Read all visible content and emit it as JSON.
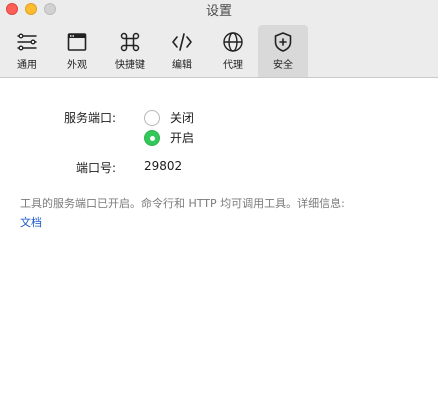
{
  "window": {
    "title": "设置",
    "traffic_lights": [
      "close",
      "minimize",
      "zoom"
    ]
  },
  "toolbar": {
    "tabs": [
      {
        "label": "通用",
        "icon": "sliders-icon",
        "active": false
      },
      {
        "label": "外观",
        "icon": "window-icon",
        "active": false
      },
      {
        "label": "快捷键",
        "icon": "command-key-icon",
        "active": false
      },
      {
        "label": "编辑",
        "icon": "code-brackets-icon",
        "active": false
      },
      {
        "label": "代理",
        "icon": "globe-icon",
        "active": false
      },
      {
        "label": "安全",
        "icon": "shield-plus-icon",
        "active": true
      }
    ]
  },
  "settings": {
    "service_port_label": "服务端口:",
    "options": [
      {
        "label": "关闭",
        "selected": false
      },
      {
        "label": "开启",
        "selected": true
      }
    ],
    "port_number_label": "端口号:",
    "port_number_value": "29802",
    "info_text": "工具的服务端口已开启。命令行和 HTTP 均可调用工具。详细信息:",
    "doc_link": "文档"
  },
  "colors": {
    "accent_radio": "#34c759",
    "link": "#1a57c6",
    "info_text": "#7a7a7a"
  }
}
